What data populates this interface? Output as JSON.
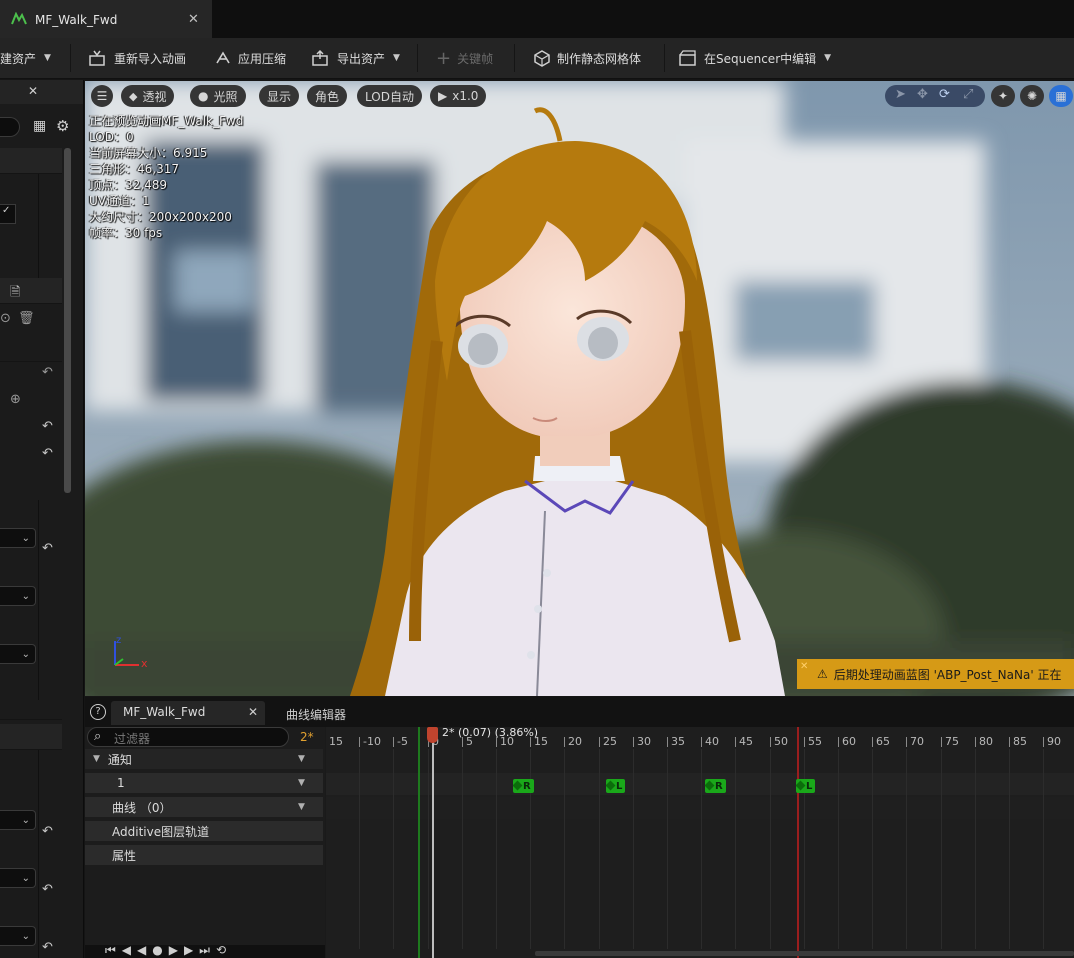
{
  "tab": {
    "title": "MF_Walk_Fwd",
    "close": "✕"
  },
  "toolbar": {
    "create_asset": "建资产",
    "reimport": "重新导入动画",
    "apply_compression": "应用压缩",
    "export_asset": "导出资产",
    "keyframe": "关键帧",
    "make_static_mesh": "制作静态网格体",
    "edit_in_sequencer": "在Sequencer中编辑"
  },
  "viewport": {
    "perspective": "透视",
    "lit": "光照",
    "show": "显示",
    "character": "角色",
    "lod_auto": "LOD自动",
    "play_rate": "x1.0",
    "stats": {
      "previewing": "正在预览动画MF_Walk_Fwd",
      "lod": "LOD：0",
      "screen_size": "当前屏幕大小：6.915",
      "triangles": "三角形：46,317",
      "vertices": "顶点：32,489",
      "uv_channels": "UV通道：1",
      "approx_size": "大约尺寸：200x200x200",
      "framerate": "帧率：30 fps"
    },
    "axis_x": "x",
    "axis_z": "z",
    "warning": "后期处理动画蓝图 'ABP_Post_NaNa' 正在"
  },
  "bottom": {
    "asset_tab": "MF_Walk_Fwd",
    "curve_editor_tab": "曲线编辑器",
    "filter_placeholder": "过滤器",
    "filter_count": "2*",
    "tracks": {
      "notifies": "通知",
      "notify_track_1": "1",
      "curves": "曲线 （0）",
      "additive": "Additive图层轨道",
      "attributes": "属性"
    },
    "playhead_label": "2* (0.07) (3.86%)",
    "ruler": [
      "15",
      "-10",
      "-5",
      "0",
      "5",
      "10",
      "15",
      "20",
      "25",
      "30",
      "35",
      "40",
      "45",
      "50",
      "55",
      "60",
      "65",
      "70",
      "75",
      "80",
      "85",
      "90"
    ],
    "keys": [
      "R",
      "L",
      "R",
      "L"
    ]
  },
  "colors": {
    "accent": "#1aa81a",
    "warning": "#d69a16",
    "playhead": "#c0442e"
  }
}
